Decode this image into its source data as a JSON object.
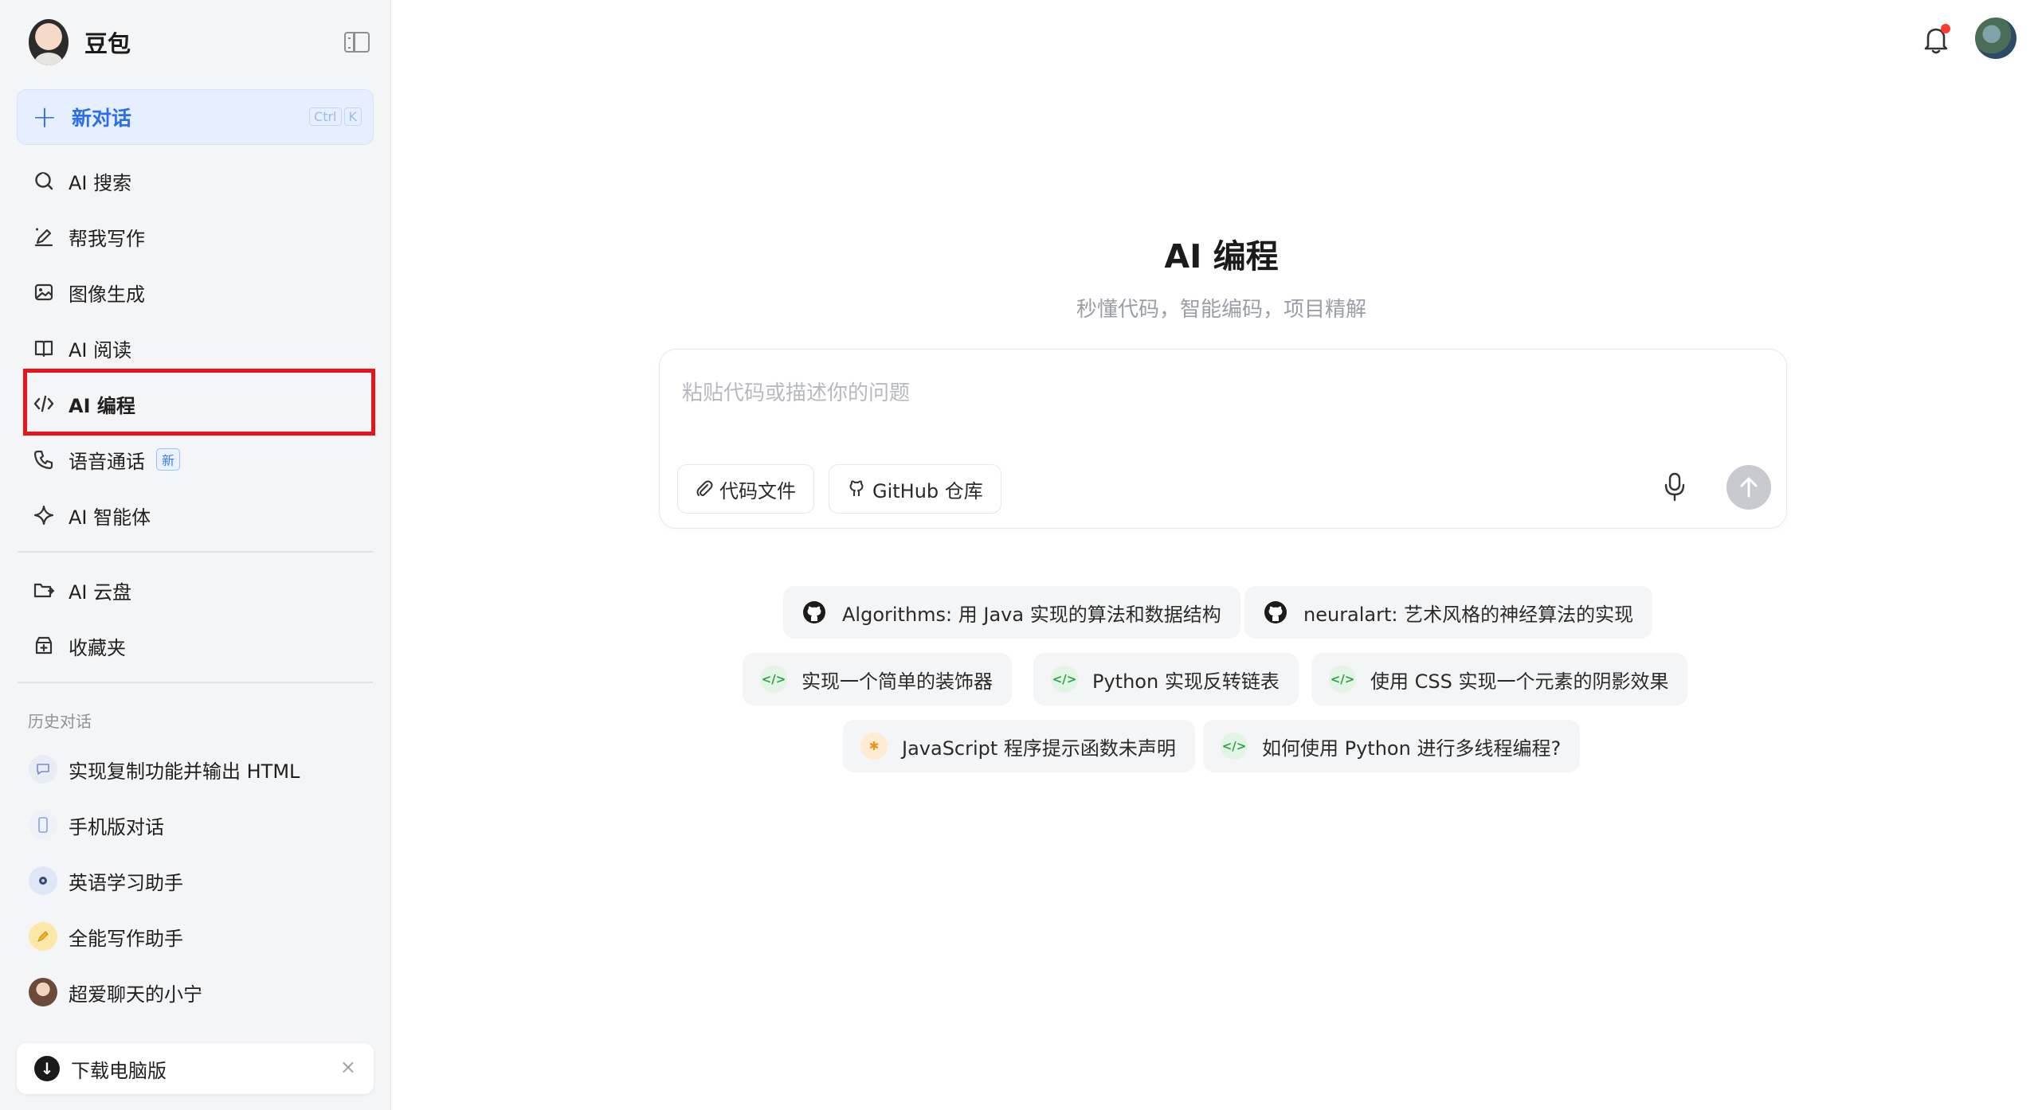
{
  "app": {
    "name": "豆包"
  },
  "sidebar": {
    "new_chat": {
      "label": "新对话",
      "shortcut": [
        "Ctrl",
        "K"
      ]
    },
    "nav": [
      {
        "label": "AI 搜索",
        "icon": "search-icon"
      },
      {
        "label": "帮我写作",
        "icon": "pen-icon"
      },
      {
        "label": "图像生成",
        "icon": "image-icon"
      },
      {
        "label": "AI 阅读",
        "icon": "book-icon"
      },
      {
        "label": "AI 编程",
        "icon": "code-icon",
        "active": true
      },
      {
        "label": "语音通话",
        "icon": "phone-icon",
        "badge": "新"
      },
      {
        "label": "AI 智能体",
        "icon": "sparkle-icon"
      }
    ],
    "tools": [
      {
        "label": "AI 云盘",
        "icon": "cloud-drive-icon"
      },
      {
        "label": "收藏夹",
        "icon": "favorites-icon"
      }
    ],
    "history_label": "历史对话",
    "history": [
      {
        "label": "实现复制功能并输出 HTML",
        "icon": "chat-bubble-icon"
      },
      {
        "label": "手机版对话",
        "icon": "phone-device-icon"
      },
      {
        "label": "英语学习助手",
        "icon": "assistant-avatar-icon"
      },
      {
        "label": "全能写作助手",
        "icon": "pencil-avatar-icon"
      },
      {
        "label": "超爱聊天的小宁",
        "icon": "girl-avatar-icon"
      }
    ],
    "download": {
      "label": "下载电脑版",
      "close": "×"
    }
  },
  "main": {
    "title": "AI 编程",
    "subtitle": "秒懂代码，智能编码，项目精解",
    "composer": {
      "placeholder": "粘贴代码或描述你的问题",
      "buttons": [
        {
          "label": "代码文件",
          "icon": "paperclip-icon"
        },
        {
          "label": "GitHub 仓库",
          "icon": "github-icon"
        }
      ]
    },
    "suggestions": [
      {
        "label": "Algorithms: 用 Java 实现的算法和数据结构",
        "icon": "github-icon"
      },
      {
        "label": "neuralart: 艺术风格的神经算法的实现",
        "icon": "github-icon"
      },
      {
        "label": "实现一个简单的装饰器",
        "icon": "code-icon"
      },
      {
        "label": "Python 实现反转链表",
        "icon": "code-icon"
      },
      {
        "label": "使用 CSS 实现一个元素的阴影效果",
        "icon": "code-icon"
      },
      {
        "label": "JavaScript 程序提示函数未声明",
        "icon": "bug-icon"
      },
      {
        "label": "如何使用 Python 进行多线程编程?",
        "icon": "code-icon"
      }
    ]
  },
  "colors": {
    "accent": "#2b6cf0",
    "highlight": "#e8131b",
    "notification": "#ff3b30"
  }
}
